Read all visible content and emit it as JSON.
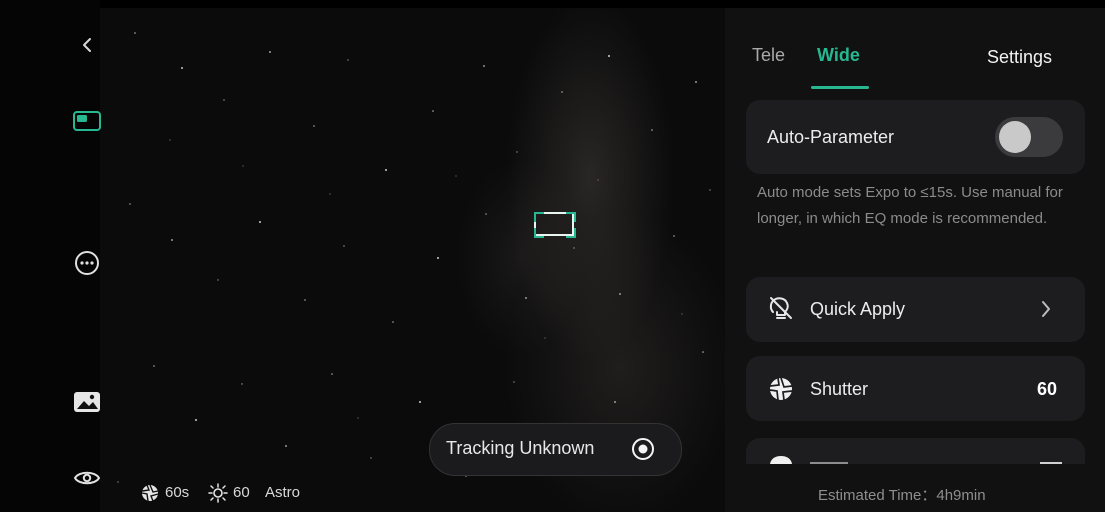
{
  "navigation": {
    "back_icon": "chevron-left-icon",
    "side_icons": [
      "layout-icon",
      "more-icon",
      "gallery-icon",
      "eye-icon"
    ]
  },
  "tabs": [
    {
      "label": "Tele",
      "active": false
    },
    {
      "label": "Wide",
      "active": true
    }
  ],
  "settings_label": "Settings",
  "auto_parameter": {
    "label": "Auto-Parameter",
    "enabled": false
  },
  "auto_note": "Auto mode sets Expo to ≤15s. Use manual for longer, in which EQ mode is recommended.",
  "quick_apply": {
    "label": "Quick Apply"
  },
  "shutter": {
    "label": "Shutter",
    "value": "60"
  },
  "tracking": {
    "label": "Tracking Unknown"
  },
  "status": {
    "shutter_value": "60s",
    "brightness_value": "60",
    "mode": "Astro"
  },
  "estimated_time": "Estimated Time：4h9min",
  "colors": {
    "accent": "#27b891",
    "panel": "#111112",
    "card": "#1d1d1f"
  }
}
